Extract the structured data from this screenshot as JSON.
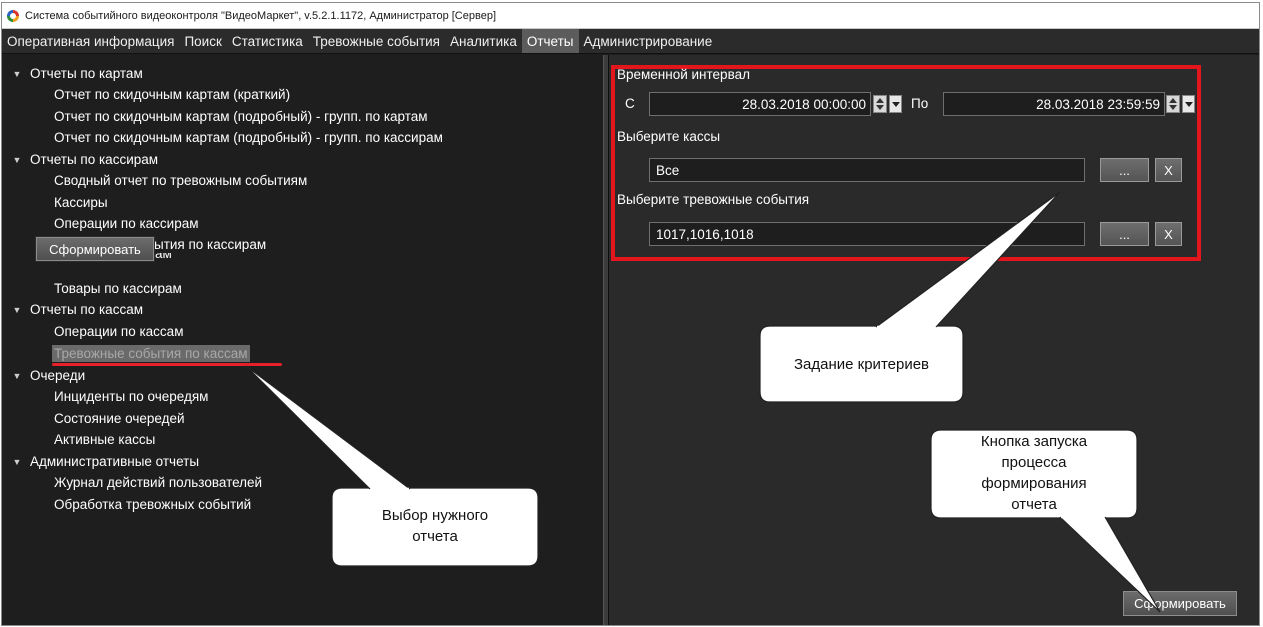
{
  "window": {
    "title": "Система событийного видеоконтроля \"ВидеоМаркет\", v.5.2.1.1172, Администратор  [Сервер]"
  },
  "menu": [
    {
      "label": "Оперативная информация"
    },
    {
      "label": "Поиск"
    },
    {
      "label": "Статистика"
    },
    {
      "label": "Тревожные события"
    },
    {
      "label": "Аналитика"
    },
    {
      "label": "Отчеты",
      "active": true
    },
    {
      "label": "Администрирование"
    }
  ],
  "tree": {
    "groups": [
      {
        "label": "Отчеты по картам",
        "items": [
          {
            "label": "Отчет по скидочным картам (краткий)"
          },
          {
            "label": "Отчет по скидочным картам (подробный) - групп. по картам"
          },
          {
            "label": "Отчет по скидочным картам (подробный) - групп. по кассирам"
          }
        ]
      },
      {
        "label": "Отчеты по кассирам",
        "items": [
          {
            "label": "Сводный отчет по тревожным событиям"
          },
          {
            "label": "Кассиры"
          },
          {
            "label": "Операции по кассирам"
          },
          {
            "label": "Тревожные события по кассирам"
          },
          {
            "label": "Чеки по кассирам"
          },
          {
            "label": "Товары по кассирам"
          }
        ]
      },
      {
        "label": "Отчеты по кассам",
        "items": [
          {
            "label": "Операции по кассам"
          },
          {
            "label": "Тревожные события по кассам",
            "selected": true
          }
        ]
      },
      {
        "label": "Очереди",
        "items": [
          {
            "label": "Инциденты по очередям"
          },
          {
            "label": "Состояние очередей"
          },
          {
            "label": "Активные кассы"
          }
        ]
      },
      {
        "label": "Административные отчеты",
        "items": [
          {
            "label": "Журнал действий пользователей"
          },
          {
            "label": "Обработка тревожных событий"
          }
        ]
      }
    ],
    "visible_fragments": {
      "alarms_by_cashier_tail": "ытия по кассирам",
      "checks_by_cashier_tail": "Теки по кассирам"
    }
  },
  "buttons": {
    "generate_left": "Сформировать",
    "generate_right": "Сформировать",
    "ellipsis": "...",
    "clear": "X"
  },
  "criteria": {
    "interval_label": "Временной интервал",
    "from_label": "С",
    "from_value": "28.03.2018 00:00:00",
    "to_label": "По",
    "to_value": "28.03.2018 23:59:59",
    "registers_label": "Выберите кассы",
    "registers_value": "Все",
    "events_label": "Выберите тревожные события",
    "events_value": "1017,1016,1018"
  },
  "callouts": {
    "select_report": [
      "Выбор нужного",
      "отчета"
    ],
    "criteria": [
      "Задание критериев"
    ],
    "launch": [
      "Кнопка запуска",
      "процесса",
      "формирования",
      "отчета"
    ]
  },
  "colors": {
    "highlight_red": "#e3151d",
    "background_dark": "#1e1e1e",
    "menu_active": "#5c5c5c"
  }
}
